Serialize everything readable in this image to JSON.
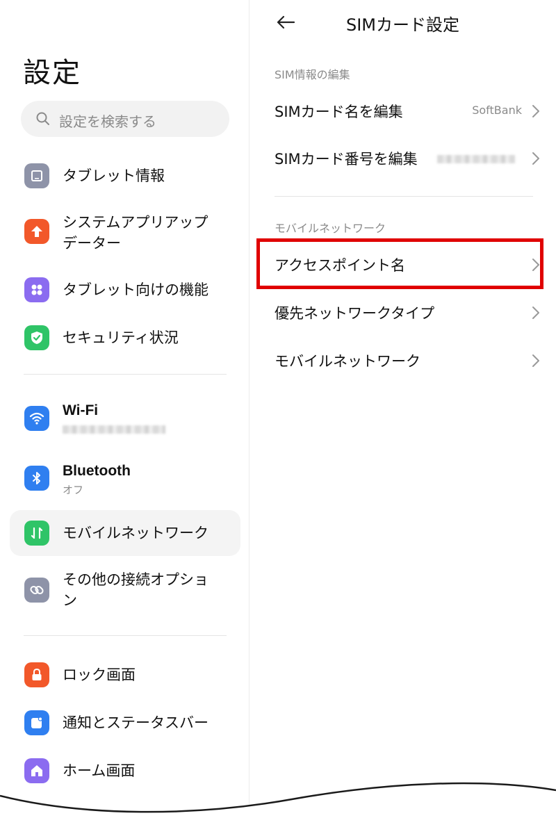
{
  "left": {
    "title": "設定",
    "search_placeholder": "設定を検索する",
    "items": [
      {
        "label": "タブレット情報",
        "icon": "tablet-icon",
        "color": "#8e93a8"
      },
      {
        "label": "システムアプリアップデーター",
        "icon": "arrow-up-icon",
        "color": "#f2582a"
      },
      {
        "label": "タブレット向けの機能",
        "icon": "grid-icon",
        "color": "#8b6cf0"
      },
      {
        "label": "セキュリティ状況",
        "icon": "shield-check-icon",
        "color": "#2fc467"
      },
      {
        "label": "Wi-Fi",
        "icon": "wifi-icon",
        "color": "#2f7ff0"
      },
      {
        "label": "Bluetooth",
        "sub": "オフ",
        "icon": "bluetooth-icon",
        "color": "#2f7ff0"
      },
      {
        "label": "モバイルネットワーク",
        "icon": "mobile-data-icon",
        "color": "#2fc467"
      },
      {
        "label": "その他の接続オプション",
        "icon": "link-icon",
        "color": "#8e93a8"
      },
      {
        "label": "ロック画面",
        "icon": "lock-icon",
        "color": "#f2582a"
      },
      {
        "label": "通知とステータスバー",
        "icon": "notification-icon",
        "color": "#2f7ff0"
      },
      {
        "label": "ホーム画面",
        "icon": "home-icon",
        "color": "#8b6cf0"
      }
    ]
  },
  "right": {
    "title": "SIMカード設定",
    "section_sim": "SIM情報の編集",
    "section_mobile": "モバイルネットワーク",
    "rows": [
      {
        "label": "SIMカード名を編集",
        "value": "SoftBank"
      },
      {
        "label": "SIMカード番号を編集"
      },
      {
        "label": "アクセスポイント名"
      },
      {
        "label": "優先ネットワークタイプ"
      },
      {
        "label": "モバイルネットワーク"
      }
    ]
  },
  "colors": {
    "highlight": "#e00000",
    "selected_bg": "#f4f4f4"
  }
}
